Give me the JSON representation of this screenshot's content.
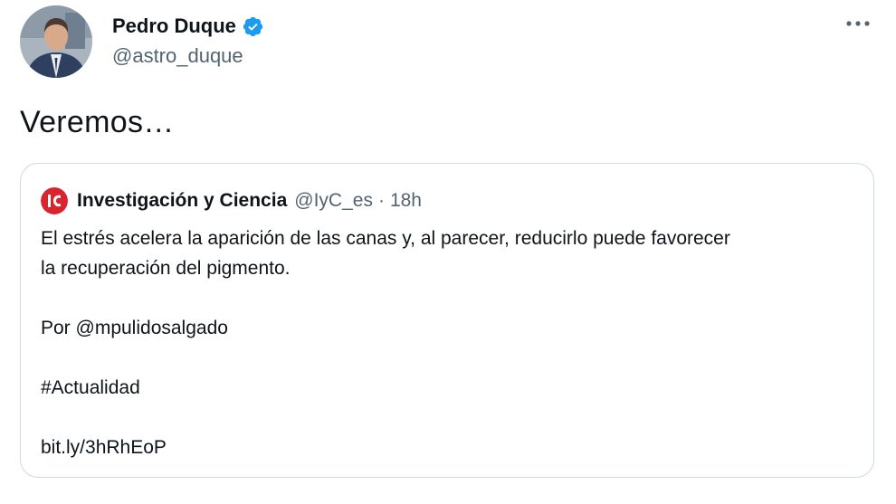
{
  "tweet": {
    "author": {
      "display_name": "Pedro Duque",
      "handle": "@astro_duque"
    },
    "text": "Veremos…",
    "more_icon": "more-horizontal-icon"
  },
  "quoted_tweet": {
    "author": {
      "display_name": "Investigación y Ciencia",
      "handle": "@IyC_es"
    },
    "separator": "·",
    "time": "18h",
    "body": {
      "line1": "El estrés acelera la aparición de las canas y, al parecer, reducirlo puede favorecer",
      "line2": "la recuperación del pigmento.",
      "credit": "Por @mpulidosalgado",
      "hashtag": "#Actualidad",
      "link": "bit.ly/3hRhEoP"
    }
  },
  "colors": {
    "text_primary": "#0f1419",
    "text_secondary": "#536471",
    "verified": "#1d9bf0",
    "border": "#cfd9de",
    "brand_red": "#d9232d"
  }
}
